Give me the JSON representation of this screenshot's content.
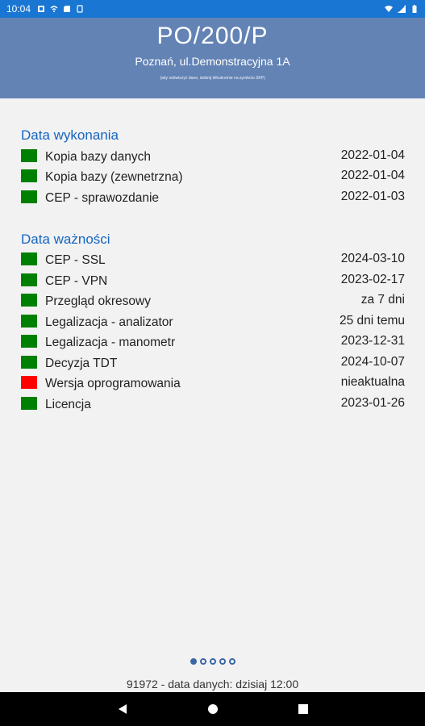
{
  "status_bar": {
    "time": "10:04"
  },
  "header": {
    "title": "PO/200/P",
    "subtitle": "Poznań, ul.Demonstracyjna 1A",
    "hint": "(aby odświeżyć dane, dotknij kilkukrotnie na symbolu SKP)"
  },
  "sections": [
    {
      "title": "Data wykonania",
      "items": [
        {
          "label": "Kopia bazy danych",
          "value": "2022-01-04",
          "status_color": "#008000"
        },
        {
          "label": "Kopia bazy (zewnetrzna)",
          "value": "2022-01-04",
          "status_color": "#008000"
        },
        {
          "label": "CEP - sprawozdanie",
          "value": "2022-01-03",
          "status_color": "#008000"
        }
      ]
    },
    {
      "title": "Data ważności",
      "items": [
        {
          "label": "CEP - SSL",
          "value": "2024-03-10",
          "status_color": "#008000"
        },
        {
          "label": "CEP - VPN",
          "value": "2023-02-17",
          "status_color": "#008000"
        },
        {
          "label": "Przegląd okresowy",
          "value": "za 7 dni",
          "status_color": "#008000"
        },
        {
          "label": "Legalizacja - analizator",
          "value": "25 dni temu",
          "status_color": "#008000"
        },
        {
          "label": "Legalizacja - manometr",
          "value": "2023-12-31",
          "status_color": "#008000"
        },
        {
          "label": "Decyzja TDT",
          "value": "2024-10-07",
          "status_color": "#008000"
        },
        {
          "label": "Wersja oprogramowania",
          "value": "nieaktualna",
          "status_color": "#ff0000"
        },
        {
          "label": "Licencja",
          "value": "2023-01-26",
          "status_color": "#008000"
        }
      ]
    }
  ],
  "pager": {
    "count": 5,
    "active": 0
  },
  "footer": {
    "text": "91972 - data danych: dzisiaj 12:00"
  },
  "colors": {
    "header_bg": "#6383b5",
    "statusbar_bg": "#1976d2",
    "section_title": "#1565c0"
  }
}
